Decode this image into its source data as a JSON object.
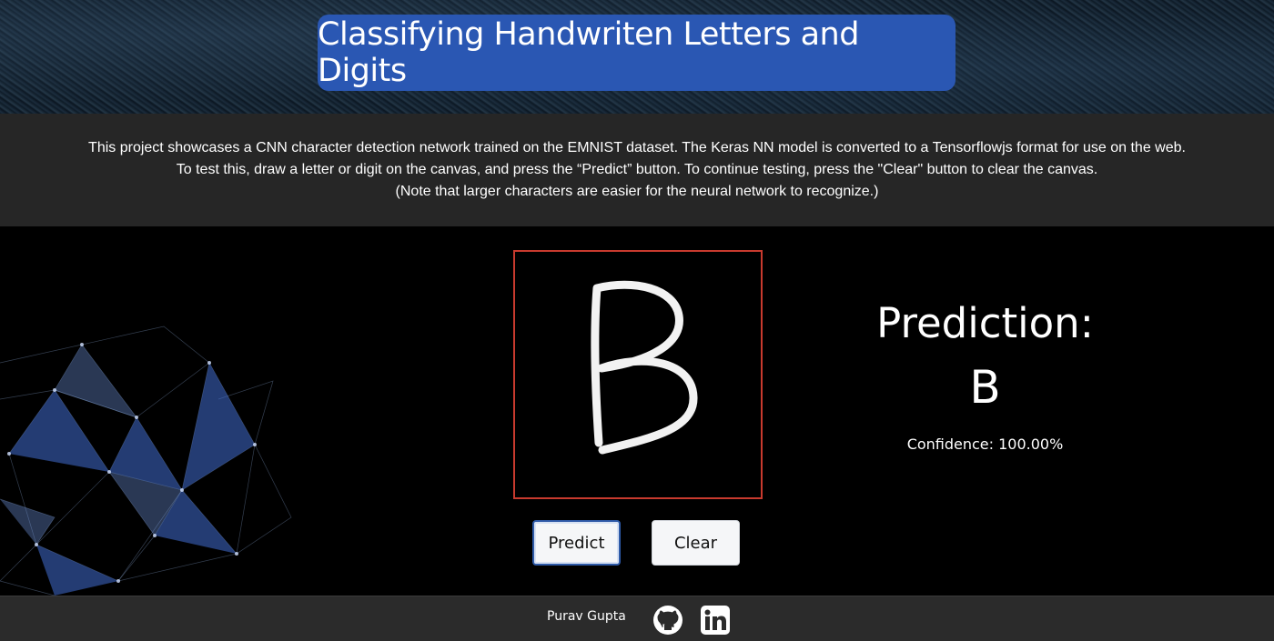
{
  "header": {
    "title": "Classifying Handwriten Letters and Digits"
  },
  "description": {
    "lines": [
      "This project showcases a CNN character detection network trained on the EMNIST dataset. The Keras NN model is converted to a Tensorflowjs format for use on the web.",
      "To test this, draw a letter or digit on the canvas, and press the “Predict” button. To continue testing, press the \"Clear\" button to clear the canvas.",
      "(Note that larger characters are easier for the neural network to recognize.)"
    ]
  },
  "canvas": {
    "drawn_character": "B",
    "border_color": "#c83a2e"
  },
  "buttons": {
    "predict_label": "Predict",
    "clear_label": "Clear"
  },
  "prediction": {
    "label": "Prediction:",
    "value": "B",
    "confidence": "Confidence: 100.00%"
  },
  "footer": {
    "author": "Purav Gupta",
    "icons": [
      "github-icon",
      "linkedin-icon"
    ]
  },
  "colors": {
    "title_background": "#2a57b3",
    "description_background": "#262626",
    "footer_background": "#2b2b2b"
  }
}
